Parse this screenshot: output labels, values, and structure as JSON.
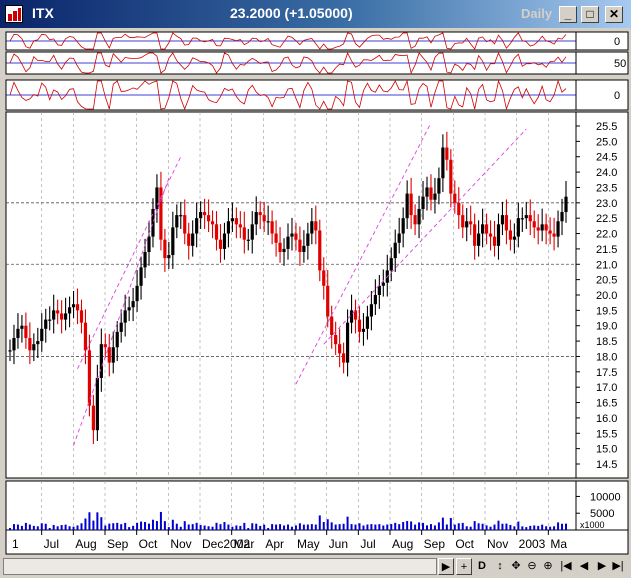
{
  "window": {
    "symbol": "ITX",
    "price_text": "23.2000 (+1.05000)",
    "period": "Daily",
    "minimize_glyph": "_",
    "maximize_glyph": "□",
    "close_glyph": "✕"
  },
  "indicators": [
    {
      "label": "0",
      "base": 0,
      "amp": 3
    },
    {
      "label": "50",
      "base": 50,
      "amp": 4
    },
    {
      "label": "0",
      "base": 0,
      "amp": 7
    }
  ],
  "price_axis": {
    "min": 14.5,
    "max": 25.5,
    "ticks": [
      "25.5",
      "25.0",
      "24.5",
      "24.0",
      "23.5",
      "23.0",
      "22.5",
      "22.0",
      "21.5",
      "21.0",
      "20.5",
      "20.0",
      "19.5",
      "19.0",
      "18.5",
      "18.0",
      "17.5",
      "17.0",
      "16.5",
      "16.0",
      "15.5",
      "15.0",
      "14.5"
    ]
  },
  "support_resistance_levels": [
    18.0,
    21.0,
    23.0
  ],
  "volume_axis": {
    "max": 14000,
    "ticks": [
      "10000",
      "5000"
    ],
    "multiplier": "x1000"
  },
  "time_axis": [
    "1",
    "Jul",
    "Aug",
    "Sep",
    "Oct",
    "Nov",
    "Dec2002",
    "Mar",
    "Apr",
    "May",
    "Jun",
    "Jul",
    "Aug",
    "Sep",
    "Oct",
    "Nov",
    "2003",
    "Ma"
  ],
  "chart_data": {
    "type": "line",
    "title": "",
    "series": [
      {
        "name": "",
        "x": [
          0,
          4,
          8,
          12,
          16,
          20,
          24,
          28,
          32,
          36,
          40,
          44,
          48,
          52,
          56,
          60,
          64,
          68,
          72,
          76,
          80,
          84,
          88,
          92,
          96,
          100,
          104,
          108,
          112,
          116,
          120,
          124,
          128,
          132,
          136,
          140,
          144,
          148,
          152,
          156,
          160,
          164,
          168,
          172,
          176,
          180,
          184,
          188,
          192,
          196,
          200,
          204,
          208,
          212,
          216,
          220,
          224,
          228,
          232,
          236,
          240,
          244,
          248,
          252,
          256,
          260,
          264,
          268,
          272,
          276,
          280,
          284,
          288,
          292,
          296,
          300,
          304,
          308,
          312,
          316,
          320,
          324,
          328,
          332,
          336,
          340,
          344,
          348,
          352,
          356,
          360,
          364,
          368,
          372,
          376,
          380,
          384,
          388,
          392,
          396,
          400,
          404,
          408,
          412,
          416,
          420,
          424,
          428,
          432,
          436,
          440,
          444,
          448,
          452,
          456,
          460,
          464,
          468,
          472,
          476,
          480,
          484,
          488,
          492,
          496,
          500,
          504,
          508,
          512,
          516,
          520,
          524,
          528,
          532,
          536,
          540,
          544,
          548,
          552,
          556,
          560
        ],
        "values": [
          18.2,
          18.6,
          18.9,
          19.0,
          18.6,
          18.2,
          18.4,
          18.5,
          18.9,
          19.2,
          19.2,
          19.5,
          19.4,
          19.2,
          19.4,
          19.6,
          19.7,
          19.5,
          19.1,
          18.2,
          16.4,
          15.6,
          17.3,
          18.4,
          18.3,
          17.8,
          18.3,
          18.8,
          19.1,
          19.5,
          19.6,
          19.8,
          20.3,
          20.9,
          21.4,
          21.9,
          22.8,
          23.5,
          21.8,
          21.2,
          21.3,
          22.2,
          22.6,
          22.6,
          22.0,
          21.6,
          22.0,
          22.5,
          22.7,
          22.6,
          22.4,
          22.3,
          21.8,
          21.5,
          22.0,
          22.4,
          22.5,
          22.3,
          22.2,
          21.8,
          21.8,
          22.3,
          22.7,
          22.6,
          22.4,
          22.4,
          22.0,
          21.7,
          21.4,
          21.5,
          21.9,
          22.0,
          21.8,
          21.4,
          21.6,
          22.0,
          22.4,
          22.1,
          20.8,
          20.3,
          19.3,
          18.7,
          18.4,
          18.1,
          17.8,
          19.1,
          19.5,
          19.2,
          18.8,
          18.9,
          19.3,
          19.7,
          20.0,
          20.3,
          20.4,
          20.8,
          21.2,
          21.7,
          22.0,
          22.5,
          23.3,
          22.6,
          22.3,
          22.8,
          23.2,
          23.5,
          23.1,
          23.3,
          23.8,
          24.8,
          24.4,
          23.3,
          23.0,
          22.6,
          22.2,
          22.4,
          22.3,
          21.6,
          22.0,
          22.3,
          22.0,
          21.9,
          21.6,
          22.3,
          22.6,
          22.1,
          21.8,
          21.9,
          22.5,
          22.5,
          22.6,
          22.4,
          22.2,
          22.1,
          22.3,
          22.1,
          22.0,
          21.9,
          22.4,
          22.7,
          23.2
        ]
      }
    ]
  }
}
